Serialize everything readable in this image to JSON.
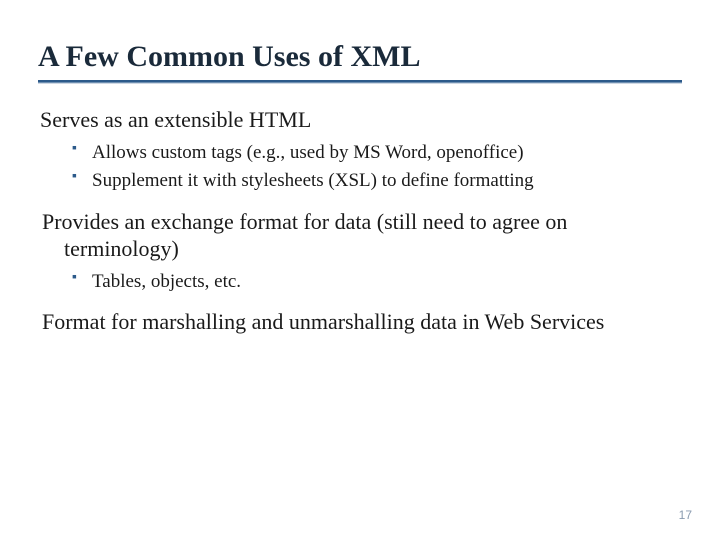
{
  "title": "A Few Common Uses of XML",
  "sections": [
    {
      "heading": "Serves as an extensible HTML",
      "bullets": [
        "Allows custom tags (e.g., used by MS Word, openoffice)",
        "Supplement it with stylesheets (XSL) to define formatting"
      ]
    },
    {
      "heading": "Provides an exchange format for data (still need to agree on terminology)",
      "bullets": [
        "Tables, objects, etc."
      ]
    },
    {
      "heading": "Format for marshalling and unmarshalling data in Web Services",
      "bullets": []
    }
  ],
  "page_number": "17"
}
